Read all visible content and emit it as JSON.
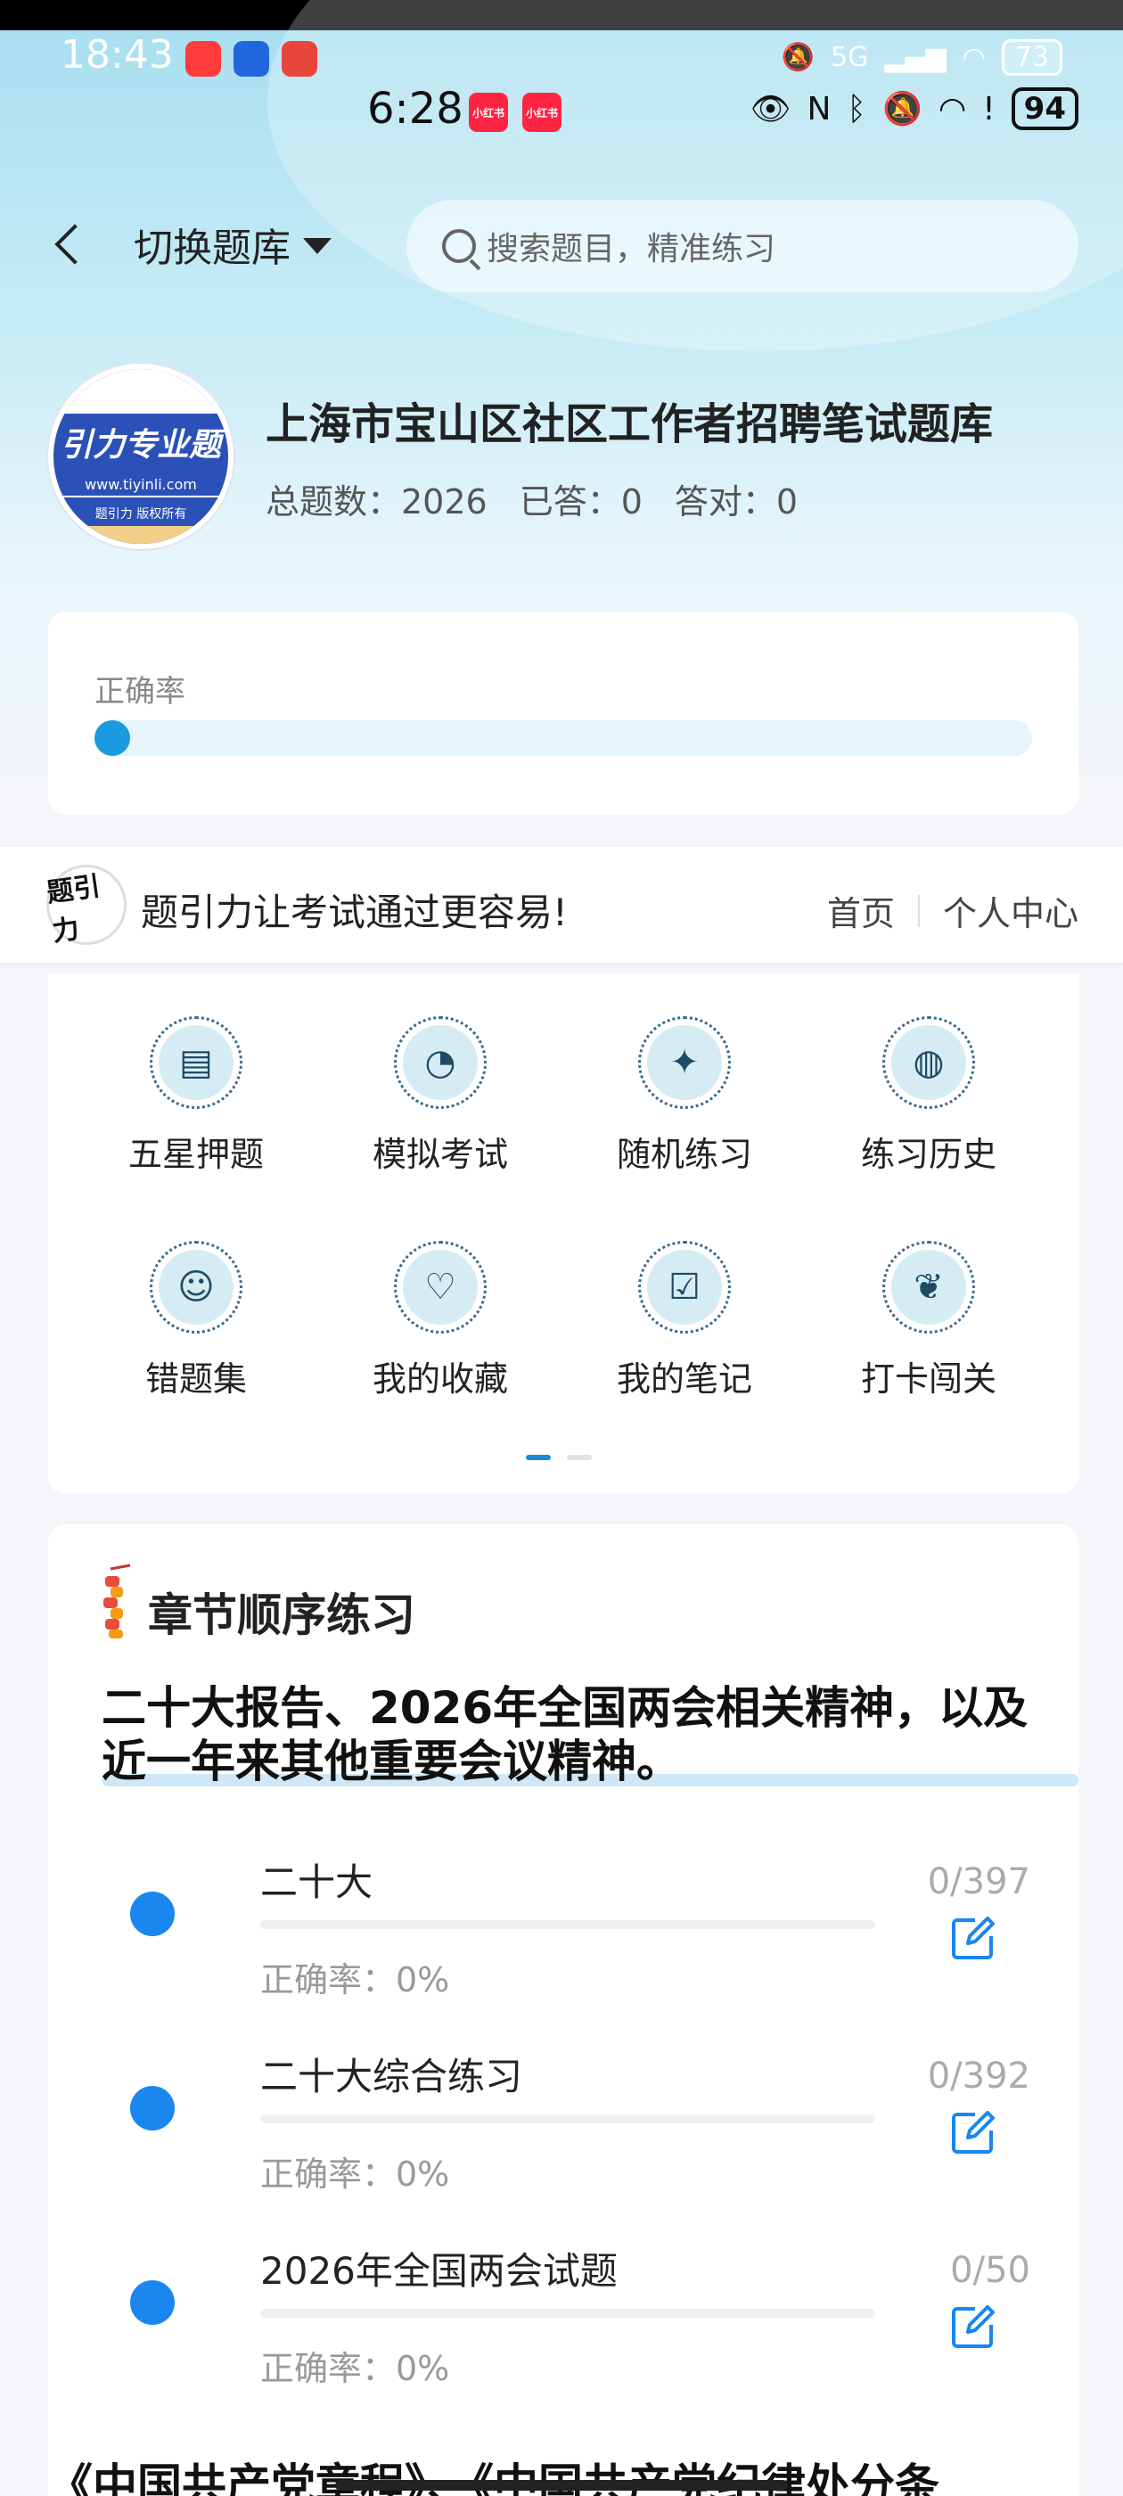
{
  "status_bar_outer": {
    "time": "18:43",
    "network": "5G",
    "battery": "73"
  },
  "status_bar_inner": {
    "time": "6:28",
    "app_badge": "小红书",
    "battery": "94"
  },
  "nav": {
    "switch_label": "切换题库",
    "search_placeholder": "搜索题目，精准练习"
  },
  "bank": {
    "logo_text": "引力专业题",
    "logo_url": "www.tiyinli.com",
    "logo_copyright": "题引力 版权所有",
    "title": "上海市宝山区社区工作者招聘笔试题库",
    "total_label": "总题数：2026",
    "answered_label": "已答：0",
    "correct_label": "答对：0"
  },
  "accuracy": {
    "label": "正确率",
    "value": 0
  },
  "banner": {
    "logo_text": "题引力",
    "slogan": "题引力让考试通过更容易!",
    "home": "首页",
    "profile": "个人中心"
  },
  "grid": {
    "items": [
      {
        "label": "五星押题",
        "icon": "id-card-icon"
      },
      {
        "label": "模拟考试",
        "icon": "gauge-icon"
      },
      {
        "label": "随机练习",
        "icon": "star-shuffle-icon"
      },
      {
        "label": "练习历史",
        "icon": "globe-history-icon"
      },
      {
        "label": "错题集",
        "icon": "head-question-icon"
      },
      {
        "label": "我的收藏",
        "icon": "heart-icon"
      },
      {
        "label": "我的笔记",
        "icon": "checkbox-note-icon"
      },
      {
        "label": "打卡闯关",
        "icon": "sprout-icon"
      }
    ],
    "page_index": 0,
    "page_count": 2
  },
  "chapter": {
    "title": "章节顺序练习",
    "section_title": "二十大报告、2026年全国两会相关精神，以及近一年来其他重要会议精神。",
    "rows": [
      {
        "name": "二十大",
        "accuracy": "正确率：0%",
        "count": "0/397"
      },
      {
        "name": "二十大综合练习",
        "accuracy": "正确率：0%",
        "count": "0/392"
      },
      {
        "name": "2026年全国两会试题",
        "accuracy": "正确率：0%",
        "count": "0/50"
      }
    ],
    "next_section_partial": "《中国共产党章程》、《中国共产党纪律处分条"
  },
  "colors": {
    "accent_blue": "#1a86f0",
    "progress_blue": "#1a9be0",
    "header_teal": "#a9dff0"
  }
}
